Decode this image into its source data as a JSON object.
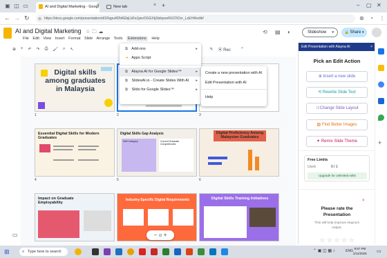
{
  "browser": {
    "tabs": [
      {
        "label": "AI and Digital Marketing - Googl",
        "close": "×"
      },
      {
        "label": "New tab",
        "close": "×"
      }
    ],
    "new_tab": "+",
    "url": "https://docs.google.com/presentation/d/1Rqpu4f2bKEbjLbFa1jwvOGGXtjStdxpxeRUC5Ocr_LxEH4/edit#"
  },
  "doc": {
    "title": "AI and Digital Marketing",
    "menu": [
      "File",
      "Edit",
      "View",
      "Insert",
      "Format",
      "Slide",
      "Arrange",
      "Tools",
      "Extensions",
      "Help"
    ],
    "slideshow_label": "Slideshow",
    "share_label": "Share",
    "rec_label": "Rec"
  },
  "extensions_menu": {
    "items": [
      {
        "label": "Add-ons",
        "icon": "puzzle-icon",
        "arrow": "▸"
      },
      {
        "label": "Apps Script",
        "icon": "apps-script-icon",
        "arrow": ""
      },
      {
        "label": "Alayna AI for Google Slides™",
        "icon": "alayna-icon",
        "arrow": "▸"
      },
      {
        "label": "SlidesAI.io - Create Slides With AI",
        "icon": "slidesai-icon",
        "arrow": "▸"
      },
      {
        "label": "Slido for Google Slides™",
        "icon": "slido-icon",
        "arrow": "▸"
      }
    ],
    "submenu": [
      {
        "label": "Create a new presentation with AI"
      },
      {
        "label": "Edit Presentation with AI"
      },
      {
        "label": "Help"
      }
    ]
  },
  "slides": [
    {
      "num": "1",
      "title": "Digital skills among graduates in Malaysia"
    },
    {
      "num": "2",
      "title": ""
    },
    {
      "num": "3",
      "title": ""
    },
    {
      "num": "4",
      "title": "Essential Digital Skills for Modern Graduates"
    },
    {
      "num": "5",
      "title": "Digital Skills Gap Analysis"
    },
    {
      "num": "6",
      "title": "Digital Proficiency Among Malaysian Graduates"
    },
    {
      "num": "7",
      "title": "Impact on Graduate Employability"
    },
    {
      "num": "8",
      "title": "Industry-Specific Digital Requirements"
    },
    {
      "num": "9",
      "title": "Digital Skills Training Initiatives"
    }
  ],
  "slide5": {
    "col_a": "Skill Category",
    "col_b": "Current Graduate Competencies"
  },
  "zoom": {
    "minus": "−",
    "plus": "+"
  },
  "panel": {
    "header": "Edit Presentation with Alayna AI",
    "close": "×",
    "pick_title": "Pick an Edit Action",
    "actions": [
      {
        "label": "Insert a new slide",
        "icon": "plus-circle-icon"
      },
      {
        "label": "Rewrite Slide Text",
        "icon": "rewrite-icon"
      },
      {
        "label": "Change Slide Layout",
        "icon": "shuffle-icon"
      },
      {
        "label": "Find Better Images",
        "icon": "image-icon"
      },
      {
        "label": "Remix Slide Theme",
        "icon": "magic-icon"
      }
    ],
    "free_limits_title": "Free Limits",
    "used_label": "Used",
    "used_value": "0 / 1",
    "upgrade": "Upgrade for unlimited edits",
    "rate_title": "Please rate the Presentation",
    "rate_sub": "This will help improve Alayna's output.",
    "stars": "☆ ☆ ☆ ☆ ☆"
  },
  "taskbar": {
    "search_placeholder": "Type here to search",
    "time": "9:57 PM",
    "date": "2/11/2025",
    "lang": "ENG"
  },
  "colors": {
    "accent": "#1a73e8",
    "panel_header": "#1e3a8a",
    "share_bg": "#c2e7ff"
  }
}
